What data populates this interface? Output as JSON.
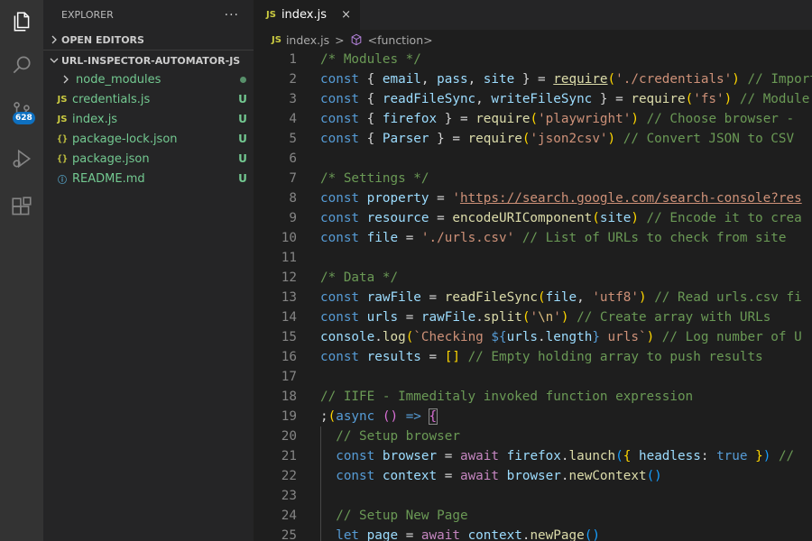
{
  "activity_bar": {
    "items": [
      {
        "name": "explorer",
        "icon": "files-icon",
        "active": true
      },
      {
        "name": "search",
        "icon": "search-icon"
      },
      {
        "name": "source-control",
        "icon": "source-control-icon",
        "badge": "628"
      },
      {
        "name": "run-and-debug",
        "icon": "run-debug-icon"
      },
      {
        "name": "extensions",
        "icon": "extensions-icon"
      }
    ]
  },
  "sidebar": {
    "title": "EXPLORER",
    "more": "···",
    "open_editors": "OPEN EDITORS",
    "project": "URL-INSPECTOR-AUTOMATOR-JS",
    "files": [
      {
        "name": "node_modules",
        "kind": "folder",
        "status": "dot"
      },
      {
        "name": "credentials.js",
        "kind": "js",
        "icon_text": "JS",
        "status": "U"
      },
      {
        "name": "index.js",
        "kind": "js",
        "icon_text": "JS",
        "status": "U"
      },
      {
        "name": "package-lock.json",
        "kind": "json",
        "icon_text": "{}",
        "status": "U"
      },
      {
        "name": "package.json",
        "kind": "json",
        "icon_text": "{}",
        "status": "U"
      },
      {
        "name": "README.md",
        "kind": "info",
        "icon_text": "ⓘ",
        "status": "U"
      }
    ]
  },
  "editor": {
    "tab": {
      "icon_text": "JS",
      "label": "index.js",
      "close": "×"
    },
    "breadcrumb": {
      "icon_text": "JS",
      "file": "index.js",
      "separator": ">",
      "symbol": "<function>"
    },
    "lines": [
      [
        [
          "c-cm",
          "/* Modules */"
        ]
      ],
      [
        [
          "c-kw",
          "const"
        ],
        [
          "",
          "{ "
        ],
        [
          "c-var",
          "email"
        ],
        [
          "",
          ", "
        ],
        [
          "c-var",
          "pass"
        ],
        [
          "",
          ", "
        ],
        [
          "c-var",
          "site"
        ],
        [
          "",
          " } = "
        ],
        [
          "c-fn u",
          "require"
        ],
        [
          "c-br1",
          "("
        ],
        [
          "c-str",
          "'./credentials'"
        ],
        [
          "c-br1",
          ")"
        ],
        [
          "",
          " "
        ],
        [
          "c-cm",
          "// Import"
        ]
      ],
      [
        [
          "c-kw",
          "const"
        ],
        [
          "",
          "{ "
        ],
        [
          "c-var",
          "readFileSync"
        ],
        [
          "",
          ", "
        ],
        [
          "c-var",
          "writeFileSync"
        ],
        [
          "",
          " } = "
        ],
        [
          "c-fn",
          "require"
        ],
        [
          "c-br1",
          "("
        ],
        [
          "c-str",
          "'fs'"
        ],
        [
          "c-br1",
          ")"
        ],
        [
          "",
          " "
        ],
        [
          "c-cm",
          "// Module"
        ]
      ],
      [
        [
          "c-kw",
          "const"
        ],
        [
          "",
          "{ "
        ],
        [
          "c-var",
          "firefox"
        ],
        [
          "",
          " } = "
        ],
        [
          "c-fn",
          "require"
        ],
        [
          "c-br1",
          "("
        ],
        [
          "c-str",
          "'playwright'"
        ],
        [
          "c-br1",
          ")"
        ],
        [
          "",
          " "
        ],
        [
          "c-cm",
          "// Choose browser - "
        ]
      ],
      [
        [
          "c-kw",
          "const"
        ],
        [
          "",
          "{ "
        ],
        [
          "c-var",
          "Parser"
        ],
        [
          "",
          " } = "
        ],
        [
          "c-fn",
          "require"
        ],
        [
          "c-br1",
          "("
        ],
        [
          "c-str",
          "'json2csv'"
        ],
        [
          "c-br1",
          ")"
        ],
        [
          "",
          " "
        ],
        [
          "c-cm",
          "// Convert JSON to CSV"
        ]
      ],
      [],
      [
        [
          "c-cm",
          "/* Settings */"
        ]
      ],
      [
        [
          "c-kw",
          "const"
        ],
        [
          "c-var",
          " property"
        ],
        [
          "",
          " = "
        ],
        [
          "c-str",
          "'"
        ],
        [
          "c-str u",
          "https://search.google.com/search-console?res"
        ]
      ],
      [
        [
          "c-kw",
          "const"
        ],
        [
          "c-var",
          " resource"
        ],
        [
          "",
          " = "
        ],
        [
          "c-fn",
          "encodeURIComponent"
        ],
        [
          "c-br1",
          "("
        ],
        [
          "c-var",
          "site"
        ],
        [
          "c-br1",
          ")"
        ],
        [
          "",
          " "
        ],
        [
          "c-cm",
          "// Encode it to crea"
        ]
      ],
      [
        [
          "c-kw",
          "const"
        ],
        [
          "c-var",
          " file"
        ],
        [
          "",
          " = "
        ],
        [
          "c-str",
          "'./urls.csv'"
        ],
        [
          "",
          " "
        ],
        [
          "c-cm",
          "// List of URLs to check from site"
        ]
      ],
      [],
      [
        [
          "c-cm",
          "/* Data */"
        ]
      ],
      [
        [
          "c-kw",
          "const"
        ],
        [
          "c-var",
          " rawFile"
        ],
        [
          "",
          " = "
        ],
        [
          "c-fn",
          "readFileSync"
        ],
        [
          "c-br1",
          "("
        ],
        [
          "c-var",
          "file"
        ],
        [
          "",
          ", "
        ],
        [
          "c-str",
          "'utf8'"
        ],
        [
          "c-br1",
          ")"
        ],
        [
          "",
          " "
        ],
        [
          "c-cm",
          "// Read urls.csv fi"
        ]
      ],
      [
        [
          "c-kw",
          "const"
        ],
        [
          "c-var",
          " urls"
        ],
        [
          "",
          " = "
        ],
        [
          "c-var",
          "rawFile"
        ],
        [
          "",
          "."
        ],
        [
          "c-fn",
          "split"
        ],
        [
          "c-br1",
          "("
        ],
        [
          "c-str",
          "'"
        ],
        [
          "c-esc",
          "\\n"
        ],
        [
          "c-str",
          "'"
        ],
        [
          "c-br1",
          ")"
        ],
        [
          "",
          " "
        ],
        [
          "c-cm",
          "// Create array with URLs"
        ]
      ],
      [
        [
          "c-var",
          "console"
        ],
        [
          "",
          "."
        ],
        [
          "c-fn",
          "log"
        ],
        [
          "c-br1",
          "("
        ],
        [
          "c-str",
          "`Checking "
        ],
        [
          "c-kw",
          "${"
        ],
        [
          "c-var",
          "urls"
        ],
        [
          "",
          "."
        ],
        [
          "c-var",
          "length"
        ],
        [
          "c-kw",
          "}"
        ],
        [
          "c-str",
          " urls`"
        ],
        [
          "c-br1",
          ")"
        ],
        [
          "",
          " "
        ],
        [
          "c-cm",
          "// Log number of U"
        ]
      ],
      [
        [
          "c-kw",
          "const"
        ],
        [
          "c-var",
          " results"
        ],
        [
          "",
          " = "
        ],
        [
          "c-br1",
          "[]"
        ],
        [
          "",
          " "
        ],
        [
          "c-cm",
          "// Empty holding array to push results"
        ]
      ],
      [],
      [
        [
          "c-cm",
          "// IIFE - Immeditaly invoked function expression"
        ]
      ],
      [
        [
          "",
          ";"
        ],
        [
          "c-br1",
          "("
        ],
        [
          "c-kw",
          "async"
        ],
        [
          "",
          " "
        ],
        [
          "c-br2",
          "()"
        ],
        [
          "",
          " "
        ],
        [
          "c-kw",
          "=>"
        ],
        [
          "",
          " "
        ],
        [
          "c-br2 box",
          "{"
        ]
      ],
      [
        [
          "",
          "  "
        ],
        [
          "c-cm",
          "// Setup browser"
        ]
      ],
      [
        [
          "",
          "  "
        ],
        [
          "c-kw",
          "const"
        ],
        [
          "c-var",
          " browser"
        ],
        [
          "",
          " = "
        ],
        [
          "c-ctl",
          "await"
        ],
        [
          "",
          " "
        ],
        [
          "c-var",
          "firefox"
        ],
        [
          "",
          "."
        ],
        [
          "c-fn",
          "launch"
        ],
        [
          "c-br3",
          "("
        ],
        [
          "c-br1",
          "{"
        ],
        [
          "",
          " "
        ],
        [
          "c-var",
          "headless"
        ],
        [
          "",
          ": "
        ],
        [
          "c-kw",
          "true"
        ],
        [
          "",
          " "
        ],
        [
          "c-br1",
          "}"
        ],
        [
          "c-br3",
          ")"
        ],
        [
          "",
          " "
        ],
        [
          "c-cm",
          "//"
        ]
      ],
      [
        [
          "",
          "  "
        ],
        [
          "c-kw",
          "const"
        ],
        [
          "c-var",
          " context"
        ],
        [
          "",
          " = "
        ],
        [
          "c-ctl",
          "await"
        ],
        [
          "",
          " "
        ],
        [
          "c-var",
          "browser"
        ],
        [
          "",
          "."
        ],
        [
          "c-fn",
          "newContext"
        ],
        [
          "c-br3",
          "()"
        ]
      ],
      [],
      [
        [
          "",
          "  "
        ],
        [
          "c-cm",
          "// Setup New Page"
        ]
      ],
      [
        [
          "",
          "  "
        ],
        [
          "c-kw",
          "let"
        ],
        [
          "c-var",
          " page"
        ],
        [
          "",
          " = "
        ],
        [
          "c-ctl",
          "await"
        ],
        [
          "",
          " "
        ],
        [
          "c-var",
          "context"
        ],
        [
          "",
          "."
        ],
        [
          "c-fn",
          "newPage"
        ],
        [
          "c-br3",
          "()"
        ]
      ]
    ],
    "line_start": 1
  }
}
